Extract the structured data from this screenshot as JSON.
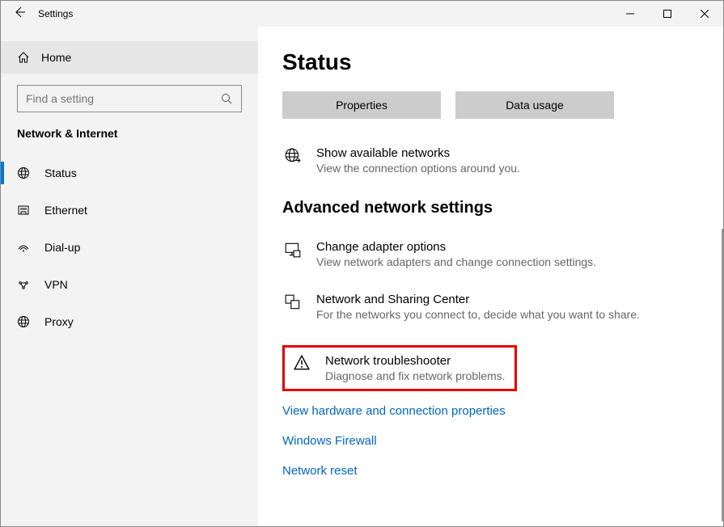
{
  "titlebar": {
    "title": "Settings"
  },
  "sidebar": {
    "home_label": "Home",
    "search_placeholder": "Find a setting",
    "category": "Network & Internet",
    "items": [
      {
        "label": "Status"
      },
      {
        "label": "Ethernet"
      },
      {
        "label": "Dial-up"
      },
      {
        "label": "VPN"
      },
      {
        "label": "Proxy"
      }
    ]
  },
  "main": {
    "title": "Status",
    "buttons": {
      "properties": "Properties",
      "data_usage": "Data usage"
    },
    "available": {
      "title": "Show available networks",
      "sub": "View the connection options around you."
    },
    "advanced_heading": "Advanced network settings",
    "adapter": {
      "title": "Change adapter options",
      "sub": "View network adapters and change connection settings."
    },
    "sharing": {
      "title": "Network and Sharing Center",
      "sub": "For the networks you connect to, decide what you want to share."
    },
    "troubleshoot": {
      "title": "Network troubleshooter",
      "sub": "Diagnose and fix network problems."
    },
    "links": {
      "hardware": "View hardware and connection properties",
      "firewall": "Windows Firewall",
      "reset": "Network reset"
    }
  }
}
